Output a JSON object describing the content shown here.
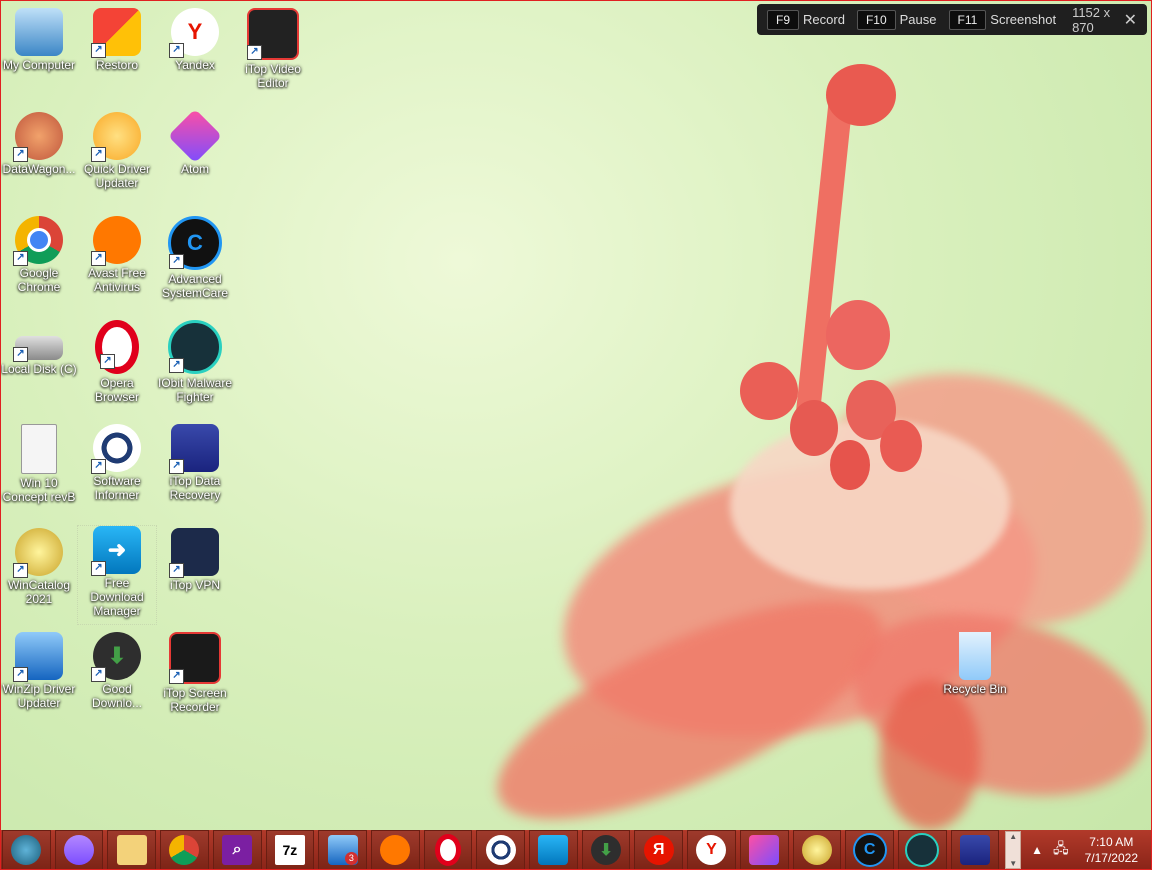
{
  "recorder": {
    "record_key": "F9",
    "record_label": "Record",
    "pause_key": "F10",
    "pause_label": "Pause",
    "screenshot_key": "F11",
    "screenshot_label": "Screenshot",
    "size": "1152 x 870",
    "close": "✕"
  },
  "desktop_icons": [
    {
      "label": "My Computer"
    },
    {
      "label": "Restoro"
    },
    {
      "label": "Yandex"
    },
    {
      "label": "iTop Video Editor"
    },
    {
      "label": "DataWagon..."
    },
    {
      "label": "Quick Driver Updater"
    },
    {
      "label": "Atom"
    },
    {
      "label": "Google Chrome"
    },
    {
      "label": "Avast Free Antivirus"
    },
    {
      "label": "Advanced SystemCare"
    },
    {
      "label": "Local Disk (C)"
    },
    {
      "label": "Opera Browser"
    },
    {
      "label": "IObit Malware Fighter"
    },
    {
      "label": "Win 10 Concept revB"
    },
    {
      "label": "Software Informer"
    },
    {
      "label": "iTop Data Recovery"
    },
    {
      "label": "WinCatalog 2021"
    },
    {
      "label": "Free Download Manager"
    },
    {
      "label": "iTop VPN"
    },
    {
      "label": "WinZip Driver Updater"
    },
    {
      "label": "Good Downlo..."
    },
    {
      "label": "iTop Screen Recorder"
    },
    {
      "label": "Recycle Bin"
    }
  ],
  "taskbar": {
    "badge_count": "3",
    "clock_time": "7:10 AM",
    "clock_date": "7/17/2022",
    "glyphs": {
      "sevenzip": "7z",
      "yandex": "Я",
      "yandex_browser": "Y",
      "itop_vpn": "C"
    }
  },
  "colors": {
    "taskbar": "#9c2f20",
    "recorder_bar": "#1f1f1f",
    "frame": "#e02020"
  }
}
